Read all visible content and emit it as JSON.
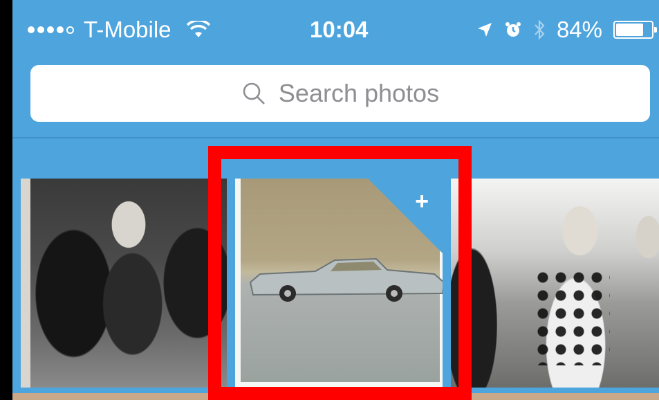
{
  "status_bar": {
    "carrier": "T-Mobile",
    "signal_bars_filled": 4,
    "signal_bars_total": 5,
    "time": "10:04",
    "battery_percent": "84%",
    "battery_level": 0.84
  },
  "search": {
    "placeholder": "Search photos"
  },
  "photos": [
    {
      "name": "woman-with-horses-photo",
      "added": false
    },
    {
      "name": "vintage-car-photo",
      "added": true,
      "action_label": "+"
    },
    {
      "name": "family-group-photo",
      "added": false
    }
  ],
  "colors": {
    "accent": "#4ea4dc",
    "highlight": "#ff0000"
  },
  "icons": [
    "wifi-icon",
    "location-arrow-icon",
    "alarm-icon",
    "bluetooth-icon",
    "battery-icon",
    "search-icon",
    "plus-icon"
  ]
}
